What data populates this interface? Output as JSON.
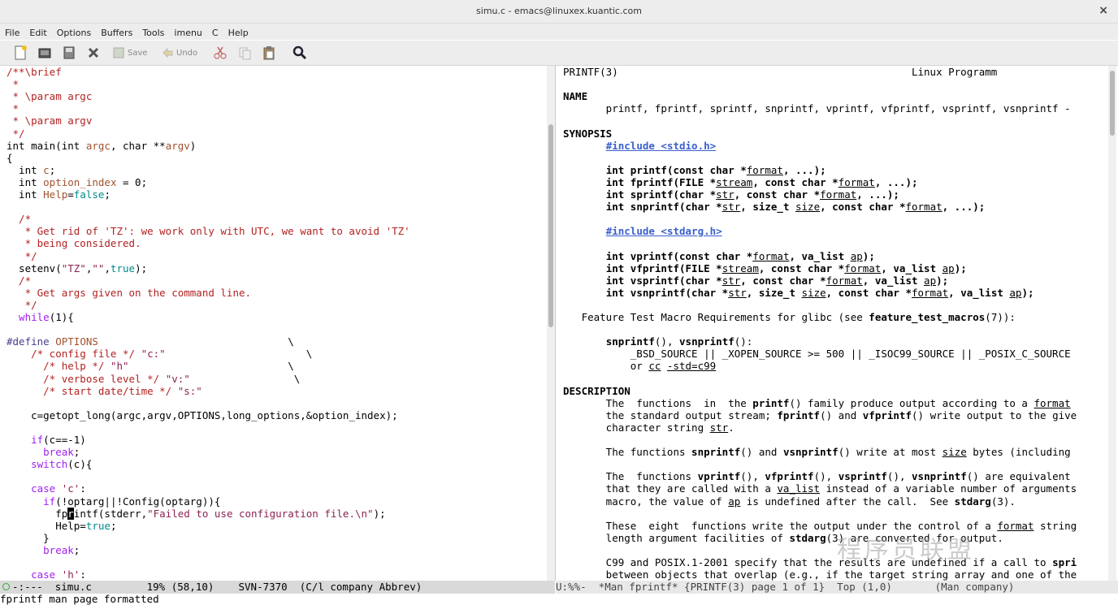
{
  "window": {
    "title": "simu.c - emacs@linuxex.kuantic.com",
    "close": "×"
  },
  "menu": [
    "File",
    "Edit",
    "Options",
    "Buffers",
    "Tools",
    "imenu",
    "C",
    "Help"
  ],
  "toolbar": {
    "save_label": "Save",
    "undo_label": "Undo"
  },
  "colors": {
    "comment": "#b22222",
    "keyword": "#a020f0",
    "type": "#228b22",
    "variable": "#a0522d",
    "string": "#8b2252",
    "constant": "#008b8b",
    "link": "#3a5fcd",
    "modeline_bg": "#d9d9d9"
  },
  "left_buffer": {
    "name": "simu.c",
    "lines": [
      [
        [
          "cm",
          "/**\\brief"
        ]
      ],
      [
        [
          "cm",
          " *"
        ]
      ],
      [
        [
          "cm",
          " * \\param argc"
        ]
      ],
      [
        [
          "cm",
          " *"
        ]
      ],
      [
        [
          "cm",
          " * \\param argv"
        ]
      ],
      [
        [
          "cm",
          " */"
        ]
      ],
      [
        [
          "",
          "int main(int "
        ],
        [
          "vr",
          "argc"
        ],
        [
          "",
          ", char **"
        ],
        [
          "vr",
          "argv"
        ],
        [
          "",
          ")"
        ]
      ],
      [
        [
          "",
          "{"
        ]
      ],
      [
        [
          "",
          "  int "
        ],
        [
          "vr",
          "c"
        ],
        [
          "",
          ";"
        ]
      ],
      [
        [
          "",
          "  int "
        ],
        [
          "vr",
          "option_index"
        ],
        [
          "",
          " = 0;"
        ]
      ],
      [
        [
          "",
          "  int "
        ],
        [
          "vr",
          "Help"
        ],
        [
          "",
          "="
        ],
        [
          "cs",
          "false"
        ],
        [
          "",
          ";"
        ]
      ],
      [
        [
          "",
          ""
        ]
      ],
      [
        [
          "cm",
          "  /*"
        ]
      ],
      [
        [
          "cm",
          "   * Get rid of 'TZ': we work only with UTC, we want to avoid 'TZ'"
        ]
      ],
      [
        [
          "cm",
          "   * being considered."
        ]
      ],
      [
        [
          "cm",
          "   */"
        ]
      ],
      [
        [
          "",
          "  setenv("
        ],
        [
          "st",
          "\"TZ\""
        ],
        [
          "",
          ","
        ],
        [
          "st",
          "\"\""
        ],
        [
          "",
          ","
        ],
        [
          "cs",
          "true"
        ],
        [
          "",
          ");"
        ]
      ],
      [
        [
          "cm",
          "  /*"
        ]
      ],
      [
        [
          "cm",
          "   * Get args given on the command line."
        ]
      ],
      [
        [
          "cm",
          "   */"
        ]
      ],
      [
        [
          "kw",
          "  while"
        ],
        [
          "",
          "(1){"
        ]
      ],
      [
        [
          "",
          ""
        ]
      ],
      [
        [
          "pp",
          "#define"
        ],
        [
          "",
          " "
        ],
        [
          "vr",
          "OPTIONS"
        ],
        [
          "",
          "                               \\"
        ]
      ],
      [
        [
          "cm",
          "    /* config file */"
        ],
        [
          "",
          " "
        ],
        [
          "st",
          "\"c:\""
        ],
        [
          "",
          "                       \\"
        ]
      ],
      [
        [
          "cm",
          "      /* help */"
        ],
        [
          "",
          " "
        ],
        [
          "st",
          "\"h\""
        ],
        [
          "",
          "                          \\"
        ]
      ],
      [
        [
          "cm",
          "      /* verbose level */"
        ],
        [
          "",
          " "
        ],
        [
          "st",
          "\"v:\""
        ],
        [
          "",
          "                 \\"
        ]
      ],
      [
        [
          "cm",
          "      /* start date/time */"
        ],
        [
          "",
          " "
        ],
        [
          "st",
          "\"s:\""
        ]
      ],
      [
        [
          "",
          ""
        ]
      ],
      [
        [
          "",
          "    c=getopt_long(argc,argv,OPTIONS,long_options,&option_index);"
        ]
      ],
      [
        [
          "",
          ""
        ]
      ],
      [
        [
          "kw",
          "    if"
        ],
        [
          "",
          "(c==-1)"
        ]
      ],
      [
        [
          "kw",
          "      break"
        ],
        [
          "",
          ";"
        ]
      ],
      [
        [
          "kw",
          "    switch"
        ],
        [
          "",
          "(c){"
        ]
      ],
      [
        [
          "",
          ""
        ]
      ],
      [
        [
          "kw",
          "    case"
        ],
        [
          "",
          " "
        ],
        [
          "st",
          "'c'"
        ],
        [
          "",
          ":"
        ]
      ],
      [
        [
          "kw",
          "      if"
        ],
        [
          "",
          "(!optarg||!Config(optarg)){"
        ]
      ],
      [
        [
          "",
          "        fp"
        ],
        [
          "cur",
          "r"
        ],
        [
          "",
          "intf(stderr,"
        ],
        [
          "st",
          "\"Failed to use configuration file.\\n\""
        ],
        [
          "",
          ");"
        ]
      ],
      [
        [
          "",
          "        Help="
        ],
        [
          "cs",
          "true"
        ],
        [
          "",
          ";"
        ]
      ],
      [
        [
          "",
          "      }"
        ]
      ],
      [
        [
          "kw",
          "      break"
        ],
        [
          "",
          ";"
        ]
      ],
      [
        [
          "",
          ""
        ]
      ],
      [
        [
          "kw",
          "    case"
        ],
        [
          "",
          " "
        ],
        [
          "st",
          "'h'"
        ],
        [
          "",
          ":"
        ]
      ]
    ]
  },
  "right_buffer": {
    "name": "*Man fprintf*",
    "lines": [
      [
        [
          "",
          "PRINTF(3)                                                Linux Programm"
        ]
      ],
      [
        [
          "",
          ""
        ]
      ],
      [
        [
          "b",
          "NAME"
        ]
      ],
      [
        [
          "",
          "       printf, fprintf, sprintf, snprintf, vprintf, vfprintf, vsprintf, vsnprintf -"
        ]
      ],
      [
        [
          "",
          ""
        ]
      ],
      [
        [
          "b",
          "SYNOPSIS"
        ]
      ],
      [
        [
          "",
          "       "
        ],
        [
          "lk",
          "#include <stdio.h>"
        ]
      ],
      [
        [
          "",
          ""
        ]
      ],
      [
        [
          "",
          "       "
        ],
        [
          "b",
          "int printf(const char *"
        ],
        [
          "u",
          "format"
        ],
        [
          "b",
          ", ...);"
        ]
      ],
      [
        [
          "",
          "       "
        ],
        [
          "b",
          "int fprintf(FILE *"
        ],
        [
          "u",
          "stream"
        ],
        [
          "b",
          ", const char *"
        ],
        [
          "u",
          "format"
        ],
        [
          "b",
          ", ...);"
        ]
      ],
      [
        [
          "",
          "       "
        ],
        [
          "b",
          "int sprintf(char *"
        ],
        [
          "u",
          "str"
        ],
        [
          "b",
          ", const char *"
        ],
        [
          "u",
          "format"
        ],
        [
          "b",
          ", ...);"
        ]
      ],
      [
        [
          "",
          "       "
        ],
        [
          "b",
          "int snprintf(char *"
        ],
        [
          "u",
          "str"
        ],
        [
          "b",
          ", size_t "
        ],
        [
          "u",
          "size"
        ],
        [
          "b",
          ", const char *"
        ],
        [
          "u",
          "format"
        ],
        [
          "b",
          ", ...);"
        ]
      ],
      [
        [
          "",
          ""
        ]
      ],
      [
        [
          "",
          "       "
        ],
        [
          "lk",
          "#include <stdarg.h>"
        ]
      ],
      [
        [
          "",
          ""
        ]
      ],
      [
        [
          "",
          "       "
        ],
        [
          "b",
          "int vprintf(const char *"
        ],
        [
          "u",
          "format"
        ],
        [
          "b",
          ", va_list "
        ],
        [
          "u",
          "ap"
        ],
        [
          "b",
          ");"
        ]
      ],
      [
        [
          "",
          "       "
        ],
        [
          "b",
          "int vfprintf(FILE *"
        ],
        [
          "u",
          "stream"
        ],
        [
          "b",
          ", const char *"
        ],
        [
          "u",
          "format"
        ],
        [
          "b",
          ", va_list "
        ],
        [
          "u",
          "ap"
        ],
        [
          "b",
          ");"
        ]
      ],
      [
        [
          "",
          "       "
        ],
        [
          "b",
          "int vsprintf(char *"
        ],
        [
          "u",
          "str"
        ],
        [
          "b",
          ", const char *"
        ],
        [
          "u",
          "format"
        ],
        [
          "b",
          ", va_list "
        ],
        [
          "u",
          "ap"
        ],
        [
          "b",
          ");"
        ]
      ],
      [
        [
          "",
          "       "
        ],
        [
          "b",
          "int vsnprintf(char *"
        ],
        [
          "u",
          "str"
        ],
        [
          "b",
          ", size_t "
        ],
        [
          "u",
          "size"
        ],
        [
          "b",
          ", const char *"
        ],
        [
          "u",
          "format"
        ],
        [
          "b",
          ", va_list "
        ],
        [
          "u",
          "ap"
        ],
        [
          "b",
          ");"
        ]
      ],
      [
        [
          "",
          ""
        ]
      ],
      [
        [
          "",
          "   Feature Test Macro Requirements for glibc (see "
        ],
        [
          "b",
          "feature_test_macros"
        ],
        [
          "",
          "(7)):"
        ]
      ],
      [
        [
          "",
          ""
        ]
      ],
      [
        [
          "",
          "       "
        ],
        [
          "b",
          "snprintf"
        ],
        [
          "",
          "(), "
        ],
        [
          "b",
          "vsnprintf"
        ],
        [
          "",
          "():"
        ]
      ],
      [
        [
          "",
          "           _BSD_SOURCE || _XOPEN_SOURCE >= 500 || _ISOC99_SOURCE || _POSIX_C_SOURCE"
        ]
      ],
      [
        [
          "",
          "           or "
        ],
        [
          "u",
          "cc"
        ],
        [
          "",
          " "
        ],
        [
          "u",
          "-std=c99"
        ]
      ],
      [
        [
          "",
          ""
        ]
      ],
      [
        [
          "b",
          "DESCRIPTION"
        ]
      ],
      [
        [
          "",
          "       The  functions  in  the "
        ],
        [
          "b",
          "printf"
        ],
        [
          "",
          "() family produce output according to a "
        ],
        [
          "u",
          "format"
        ]
      ],
      [
        [
          "",
          "       the standard output stream; "
        ],
        [
          "b",
          "fprintf"
        ],
        [
          "",
          "() and "
        ],
        [
          "b",
          "vfprintf"
        ],
        [
          "",
          "() write output to the give"
        ]
      ],
      [
        [
          "",
          "       character string "
        ],
        [
          "u",
          "str"
        ],
        [
          "",
          "."
        ]
      ],
      [
        [
          "",
          ""
        ]
      ],
      [
        [
          "",
          "       The functions "
        ],
        [
          "b",
          "snprintf"
        ],
        [
          "",
          "() and "
        ],
        [
          "b",
          "vsnprintf"
        ],
        [
          "",
          "() write at most "
        ],
        [
          "u",
          "size"
        ],
        [
          "",
          " bytes (including"
        ]
      ],
      [
        [
          "",
          ""
        ]
      ],
      [
        [
          "",
          "       The  functions "
        ],
        [
          "b",
          "vprintf"
        ],
        [
          "",
          "(), "
        ],
        [
          "b",
          "vfprintf"
        ],
        [
          "",
          "(), "
        ],
        [
          "b",
          "vsprintf"
        ],
        [
          "",
          "(), "
        ],
        [
          "b",
          "vsnprintf"
        ],
        [
          "",
          "() are equivalent"
        ]
      ],
      [
        [
          "",
          "       that they are called with a "
        ],
        [
          "u",
          "va_list"
        ],
        [
          "",
          " instead of a variable number of arguments"
        ]
      ],
      [
        [
          "",
          "       macro, the value of "
        ],
        [
          "u",
          "ap"
        ],
        [
          "",
          " is undefined after the call.  See "
        ],
        [
          "b",
          "stdarg"
        ],
        [
          "",
          "(3)."
        ]
      ],
      [
        [
          "",
          ""
        ]
      ],
      [
        [
          "",
          "       These  eight  functions write the output under the control of a "
        ],
        [
          "u",
          "format"
        ],
        [
          "",
          " string"
        ]
      ],
      [
        [
          "",
          "       length argument facilities of "
        ],
        [
          "b",
          "stdarg"
        ],
        [
          "",
          "(3) are converted for output."
        ]
      ],
      [
        [
          "",
          ""
        ]
      ],
      [
        [
          "",
          "       C99 and POSIX.1-2001 specify that the results are undefined if a call to "
        ],
        [
          "b",
          "spri"
        ]
      ],
      [
        [
          "",
          "       between objects that overlap (e.g., if the target string array and one of the"
        ]
      ]
    ]
  },
  "modeline_left": "  -:---  simu.c         19% (58,10)    SVN-7370  (C/l company Abbrev)",
  "modeline_right": "U:%%-  *Man fprintf* {PRINTF(3) page 1 of 1}  Top (1,0)       (Man company)",
  "minibuffer": "fprintf man page formatted",
  "watermark": "程序员联盟"
}
